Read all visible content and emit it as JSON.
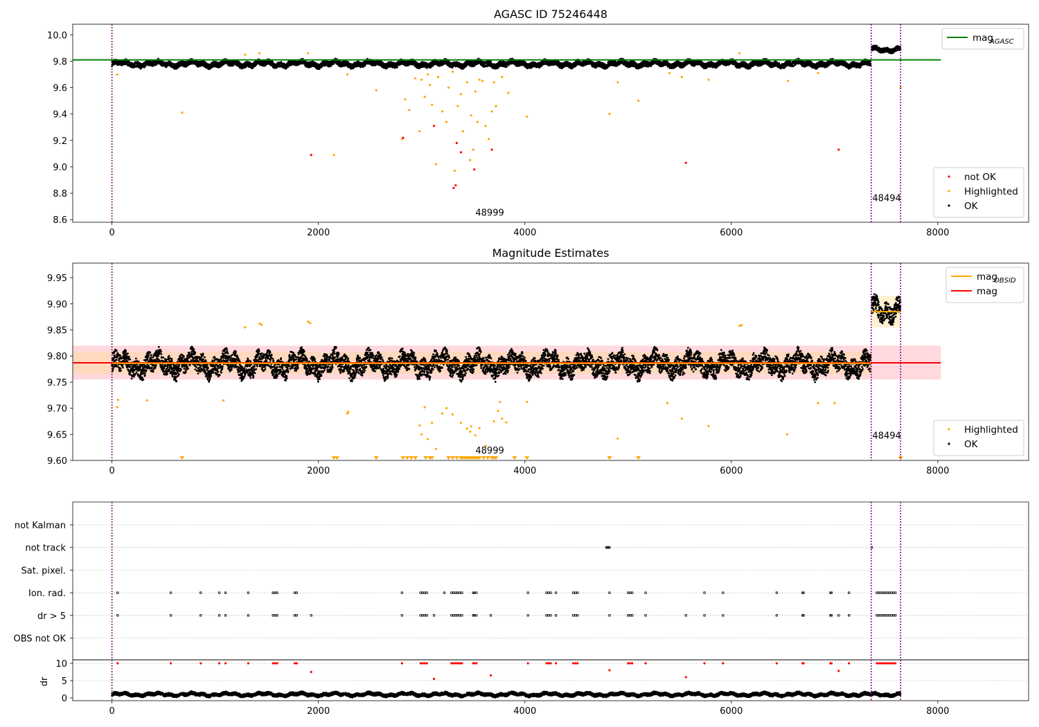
{
  "chart_data": [
    {
      "type": "scatter",
      "title": "AGASC ID 75246448",
      "xlim": [
        -380,
        8880
      ],
      "ylim": [
        8.58,
        10.08
      ],
      "xticks": [
        0,
        2000,
        4000,
        6000,
        8000
      ],
      "yticks": [
        8.6,
        8.8,
        9.0,
        9.2,
        9.4,
        9.6,
        9.8,
        10.0
      ],
      "ytick_labels": [
        "8.6",
        "8.8",
        "9.0",
        "9.2",
        "9.4",
        "9.6",
        "9.8",
        "10.0"
      ],
      "hlines": [
        {
          "name": "mag",
          "subscript": "AGASC",
          "y": 9.81,
          "x": [
            -380,
            8030
          ],
          "color": "#008000"
        }
      ],
      "vlines": [
        0,
        7355,
        7640
      ],
      "annotations": [
        {
          "text": "48999",
          "x": 3660,
          "y": 8.63
        },
        {
          "text": "48494",
          "x": 7505,
          "y": 8.74
        }
      ],
      "legend": {
        "position": "top-right",
        "entries": [
          {
            "label": "mag",
            "sub": "AGASC",
            "kind": "line",
            "color": "#008000"
          }
        ]
      },
      "legend2": {
        "position": "bottom-right",
        "entries": [
          {
            "label": "not OK",
            "kind": "dot",
            "color": "#ff0000"
          },
          {
            "label": "Highlighted",
            "kind": "dot",
            "color": "#ffa500"
          },
          {
            "label": "OK",
            "kind": "dot",
            "color": "#000000"
          }
        ]
      },
      "series": [
        {
          "name": "OK",
          "color": "#000000",
          "note": "dense band",
          "x_range": [
            0,
            7350
          ],
          "y_center": 9.78,
          "y_spread": 0.035,
          "x_range_b": [
            7360,
            7640
          ],
          "y_center_b": 9.89,
          "y_spread_b": 0.03
        },
        {
          "name": "Highlighted",
          "color": "#ffa500",
          "x": [
            50,
            680,
            1290,
            1430,
            1900,
            2150,
            2280,
            2560,
            2810,
            2840,
            2880,
            2940,
            2980,
            3000,
            3030,
            3060,
            3080,
            3100,
            3140,
            3160,
            3200,
            3240,
            3260,
            3300,
            3320,
            3350,
            3380,
            3400,
            3440,
            3470,
            3480,
            3500,
            3520,
            3540,
            3560,
            3590,
            3620,
            3650,
            3680,
            3700,
            3720,
            3780,
            3840,
            4020,
            4820,
            4900,
            5100,
            5400,
            5520,
            5780,
            6080,
            6550,
            6840,
            7640
          ],
          "y": [
            9.7,
            9.41,
            9.85,
            9.86,
            9.86,
            9.09,
            9.7,
            9.58,
            9.21,
            9.51,
            9.43,
            9.67,
            9.27,
            9.66,
            9.53,
            9.7,
            9.62,
            9.47,
            9.02,
            9.68,
            9.42,
            9.34,
            9.6,
            9.72,
            8.97,
            9.46,
            9.55,
            9.27,
            9.64,
            9.05,
            9.39,
            9.13,
            9.57,
            9.34,
            9.66,
            9.65,
            9.31,
            9.21,
            9.42,
            9.64,
            9.46,
            9.68,
            9.56,
            9.38,
            9.4,
            9.64,
            9.5,
            9.71,
            9.68,
            9.66,
            9.86,
            9.65,
            9.71,
            9.6
          ]
        },
        {
          "name": "not OK",
          "color": "#ff0000",
          "x": [
            1930,
            2820,
            3120,
            3310,
            3330,
            3340,
            3380,
            3510,
            3680,
            5560,
            7040
          ],
          "y": [
            9.09,
            9.22,
            9.31,
            8.84,
            8.86,
            9.18,
            9.11,
            8.98,
            9.13,
            9.03,
            9.13
          ]
        }
      ]
    },
    {
      "type": "scatter",
      "title": "Magnitude Estimates",
      "xlim": [
        -380,
        8880
      ],
      "ylim": [
        9.6,
        9.978
      ],
      "xticks": [
        0,
        2000,
        4000,
        6000,
        8000
      ],
      "yticks": [
        9.6,
        9.65,
        9.7,
        9.75,
        9.8,
        9.85,
        9.9,
        9.95
      ],
      "ytick_labels": [
        "9.60",
        "9.65",
        "9.70",
        "9.75",
        "9.80",
        "9.85",
        "9.90",
        "9.95"
      ],
      "bands": [
        {
          "x": [
            -380,
            8030
          ],
          "y": [
            9.755,
            9.82
          ],
          "color": "#ffc0c8"
        },
        {
          "x": [
            -380,
            7360
          ],
          "y": [
            9.765,
            9.808
          ],
          "color": "#ffd8a8"
        },
        {
          "x": [
            7360,
            7640
          ],
          "y": [
            9.855,
            9.915
          ],
          "color": "#ffe8b0"
        }
      ],
      "hlines": [
        {
          "name": "mag",
          "y": 9.787,
          "x": [
            -380,
            8030
          ],
          "color": "#ff0000"
        },
        {
          "name": "mag",
          "subscript": "OBSID",
          "y": 9.786,
          "x": [
            0,
            7360
          ],
          "color": "#ffa500"
        },
        {
          "name": "mag",
          "subscript": "OBSID",
          "y": 9.885,
          "x": [
            7360,
            7640
          ],
          "color": "#ffa500"
        }
      ],
      "vlines": [
        0,
        7355,
        7640
      ],
      "annotations": [
        {
          "text": "48999",
          "x": 3660,
          "y": 9.613
        },
        {
          "text": "48494",
          "x": 7505,
          "y": 9.642
        }
      ],
      "legend": {
        "position": "top-right",
        "entries": [
          {
            "label": "mag",
            "sub": "OBSID",
            "kind": "line",
            "color": "#ffa500"
          },
          {
            "label": "mag",
            "kind": "line",
            "color": "#ff0000"
          }
        ]
      },
      "legend2": {
        "position": "bottom-right",
        "entries": [
          {
            "label": "Highlighted",
            "kind": "dot",
            "color": "#ffa500"
          },
          {
            "label": "OK",
            "kind": "dot",
            "color": "#000000"
          }
        ]
      },
      "series": [
        {
          "name": "OK",
          "color": "#000000",
          "note": "dense band",
          "x_range": [
            0,
            7350
          ],
          "y_center": 9.784,
          "y_spread": 0.03,
          "x_range_b": [
            7360,
            7640
          ],
          "y_center_b": 9.89,
          "y_spread_b": 0.03
        },
        {
          "name": "Highlighted",
          "color": "#ffa500",
          "x": [
            50,
            60,
            340,
            1080,
            1290,
            1430,
            1450,
            1900,
            1920,
            2280,
            2290,
            2980,
            3000,
            3030,
            3060,
            3100,
            3140,
            3200,
            3240,
            3300,
            3380,
            3440,
            3470,
            3480,
            3520,
            3560,
            3620,
            3700,
            3740,
            3760,
            3780,
            3820,
            4020,
            4900,
            5380,
            5520,
            5780,
            6080,
            6100,
            6540,
            6840,
            7000
          ],
          "y": [
            9.702,
            9.716,
            9.715,
            9.715,
            9.855,
            9.862,
            9.86,
            9.866,
            9.863,
            9.69,
            9.693,
            9.667,
            9.65,
            9.702,
            9.641,
            9.672,
            9.622,
            9.69,
            9.7,
            9.688,
            9.672,
            9.661,
            9.655,
            9.665,
            9.648,
            9.662,
            9.628,
            9.675,
            9.695,
            9.712,
            9.68,
            9.673,
            9.712,
            9.642,
            9.71,
            9.68,
            9.666,
            9.858,
            9.859,
            9.65,
            9.71,
            9.71
          ]
        },
        {
          "name": "Highlighted (below axis)",
          "color": "#ffa500",
          "marker": "triangle-down",
          "x": [
            680,
            2150,
            2180,
            2560,
            2820,
            2860,
            2900,
            2940,
            3040,
            3080,
            3100,
            3260,
            3300,
            3340,
            3380,
            3400,
            3420,
            3440,
            3460,
            3480,
            3500,
            3520,
            3540,
            3560,
            3600,
            3640,
            3680,
            3700,
            3720,
            3900,
            4020,
            4820,
            5100,
            7640
          ],
          "y": [
            9.6,
            9.6,
            9.6,
            9.6,
            9.6,
            9.6,
            9.6,
            9.6,
            9.6,
            9.6,
            9.6,
            9.6,
            9.6,
            9.6,
            9.6,
            9.6,
            9.6,
            9.6,
            9.6,
            9.6,
            9.6,
            9.6,
            9.6,
            9.6,
            9.6,
            9.6,
            9.6,
            9.6,
            9.6,
            9.6,
            9.6,
            9.6,
            9.6,
            9.6
          ]
        }
      ]
    },
    {
      "type": "scatter",
      "title": "",
      "xlim": [
        -380,
        8880
      ],
      "category_axis": [
        "not Kalman",
        "not track",
        "Sat. pixel.",
        "Ion. rad.",
        "dr > 5",
        "OBS not OK"
      ],
      "vlines": [
        0,
        7355,
        7640
      ],
      "series": [
        {
          "name": "not track",
          "color": "#000000",
          "x": [
            4790,
            4800,
            4810,
            4820,
            7360
          ],
          "y": [
            "not track",
            "not track",
            "not track",
            "not track",
            "not track"
          ]
        },
        {
          "name": "Ion. rad.",
          "color": "#000000",
          "x": [
            55,
            570,
            860,
            1040,
            1100,
            1320,
            1560,
            1580,
            1600,
            1770,
            1790,
            2810,
            2990,
            3010,
            3030,
            3050,
            3220,
            3290,
            3310,
            3330,
            3350,
            3370,
            3390,
            3500,
            3510,
            3530,
            4030,
            4210,
            4230,
            4250,
            4300,
            4470,
            4490,
            4510,
            4820,
            5000,
            5020,
            5040,
            5170,
            5740,
            5920,
            6440,
            6690,
            6700,
            6960,
            6970,
            7140,
            7410,
            7430,
            7450,
            7470,
            7490,
            7510,
            7530,
            7550,
            7570,
            7590
          ],
          "y": "Ion. rad."
        },
        {
          "name": "dr > 5",
          "color": "#000000",
          "x": [
            55,
            570,
            860,
            1040,
            1100,
            1320,
            1560,
            1580,
            1600,
            1770,
            1790,
            1930,
            2810,
            2990,
            3010,
            3030,
            3050,
            3120,
            3290,
            3310,
            3330,
            3350,
            3370,
            3390,
            3500,
            3510,
            3530,
            3670,
            4030,
            4210,
            4230,
            4250,
            4300,
            4470,
            4490,
            4510,
            4820,
            5000,
            5020,
            5040,
            5170,
            5560,
            5740,
            5920,
            6440,
            6690,
            6700,
            6960,
            6970,
            7040,
            7140,
            7410,
            7430,
            7450,
            7470,
            7490,
            7510,
            7530,
            7550,
            7570,
            7590
          ],
          "y": "dr > 5"
        }
      ]
    },
    {
      "type": "scatter",
      "title": "",
      "ylabel": "dr",
      "xlim": [
        -380,
        8880
      ],
      "ylim": [
        -0.8,
        11
      ],
      "xticks": [
        0,
        2000,
        4000,
        6000,
        8000
      ],
      "yticks": [
        0,
        5,
        10
      ],
      "ytick_labels": [
        "0",
        "5",
        "10"
      ],
      "vlines": [
        0,
        7355,
        7640
      ],
      "series": [
        {
          "name": "dr",
          "color": "#000000",
          "note": "dense band",
          "x_range": [
            0,
            7640
          ],
          "y_center": 1.0,
          "y_spread": 0.8
        },
        {
          "name": "dr > 5",
          "color": "#ff0000",
          "x": [
            55,
            570,
            860,
            1040,
            1100,
            1320,
            1560,
            1580,
            1600,
            1770,
            1790,
            1930,
            2810,
            2990,
            3010,
            3030,
            3050,
            3120,
            3290,
            3310,
            3330,
            3350,
            3370,
            3390,
            3500,
            3510,
            3530,
            3670,
            4030,
            4210,
            4230,
            4250,
            4300,
            4470,
            4490,
            4510,
            4820,
            5000,
            5020,
            5040,
            5170,
            5560,
            5740,
            5920,
            6440,
            6690,
            6700,
            6960,
            6970,
            7040,
            7140,
            7410,
            7430,
            7450,
            7470,
            7490,
            7510,
            7530,
            7550,
            7570,
            7590
          ],
          "y": [
            10,
            10,
            10,
            10,
            10,
            10,
            10,
            10,
            10,
            10,
            10,
            7.5,
            10,
            10,
            10,
            10,
            10,
            5.5,
            10,
            10,
            10,
            10,
            10,
            10,
            10,
            10,
            10,
            6.5,
            10,
            10,
            10,
            10,
            10,
            10,
            10,
            10,
            8,
            10,
            10,
            10,
            10,
            6,
            10,
            10,
            10,
            10,
            10,
            10,
            10,
            7.8,
            10,
            10,
            10,
            10,
            10,
            10,
            10,
            10,
            10,
            10,
            10
          ]
        }
      ]
    }
  ]
}
